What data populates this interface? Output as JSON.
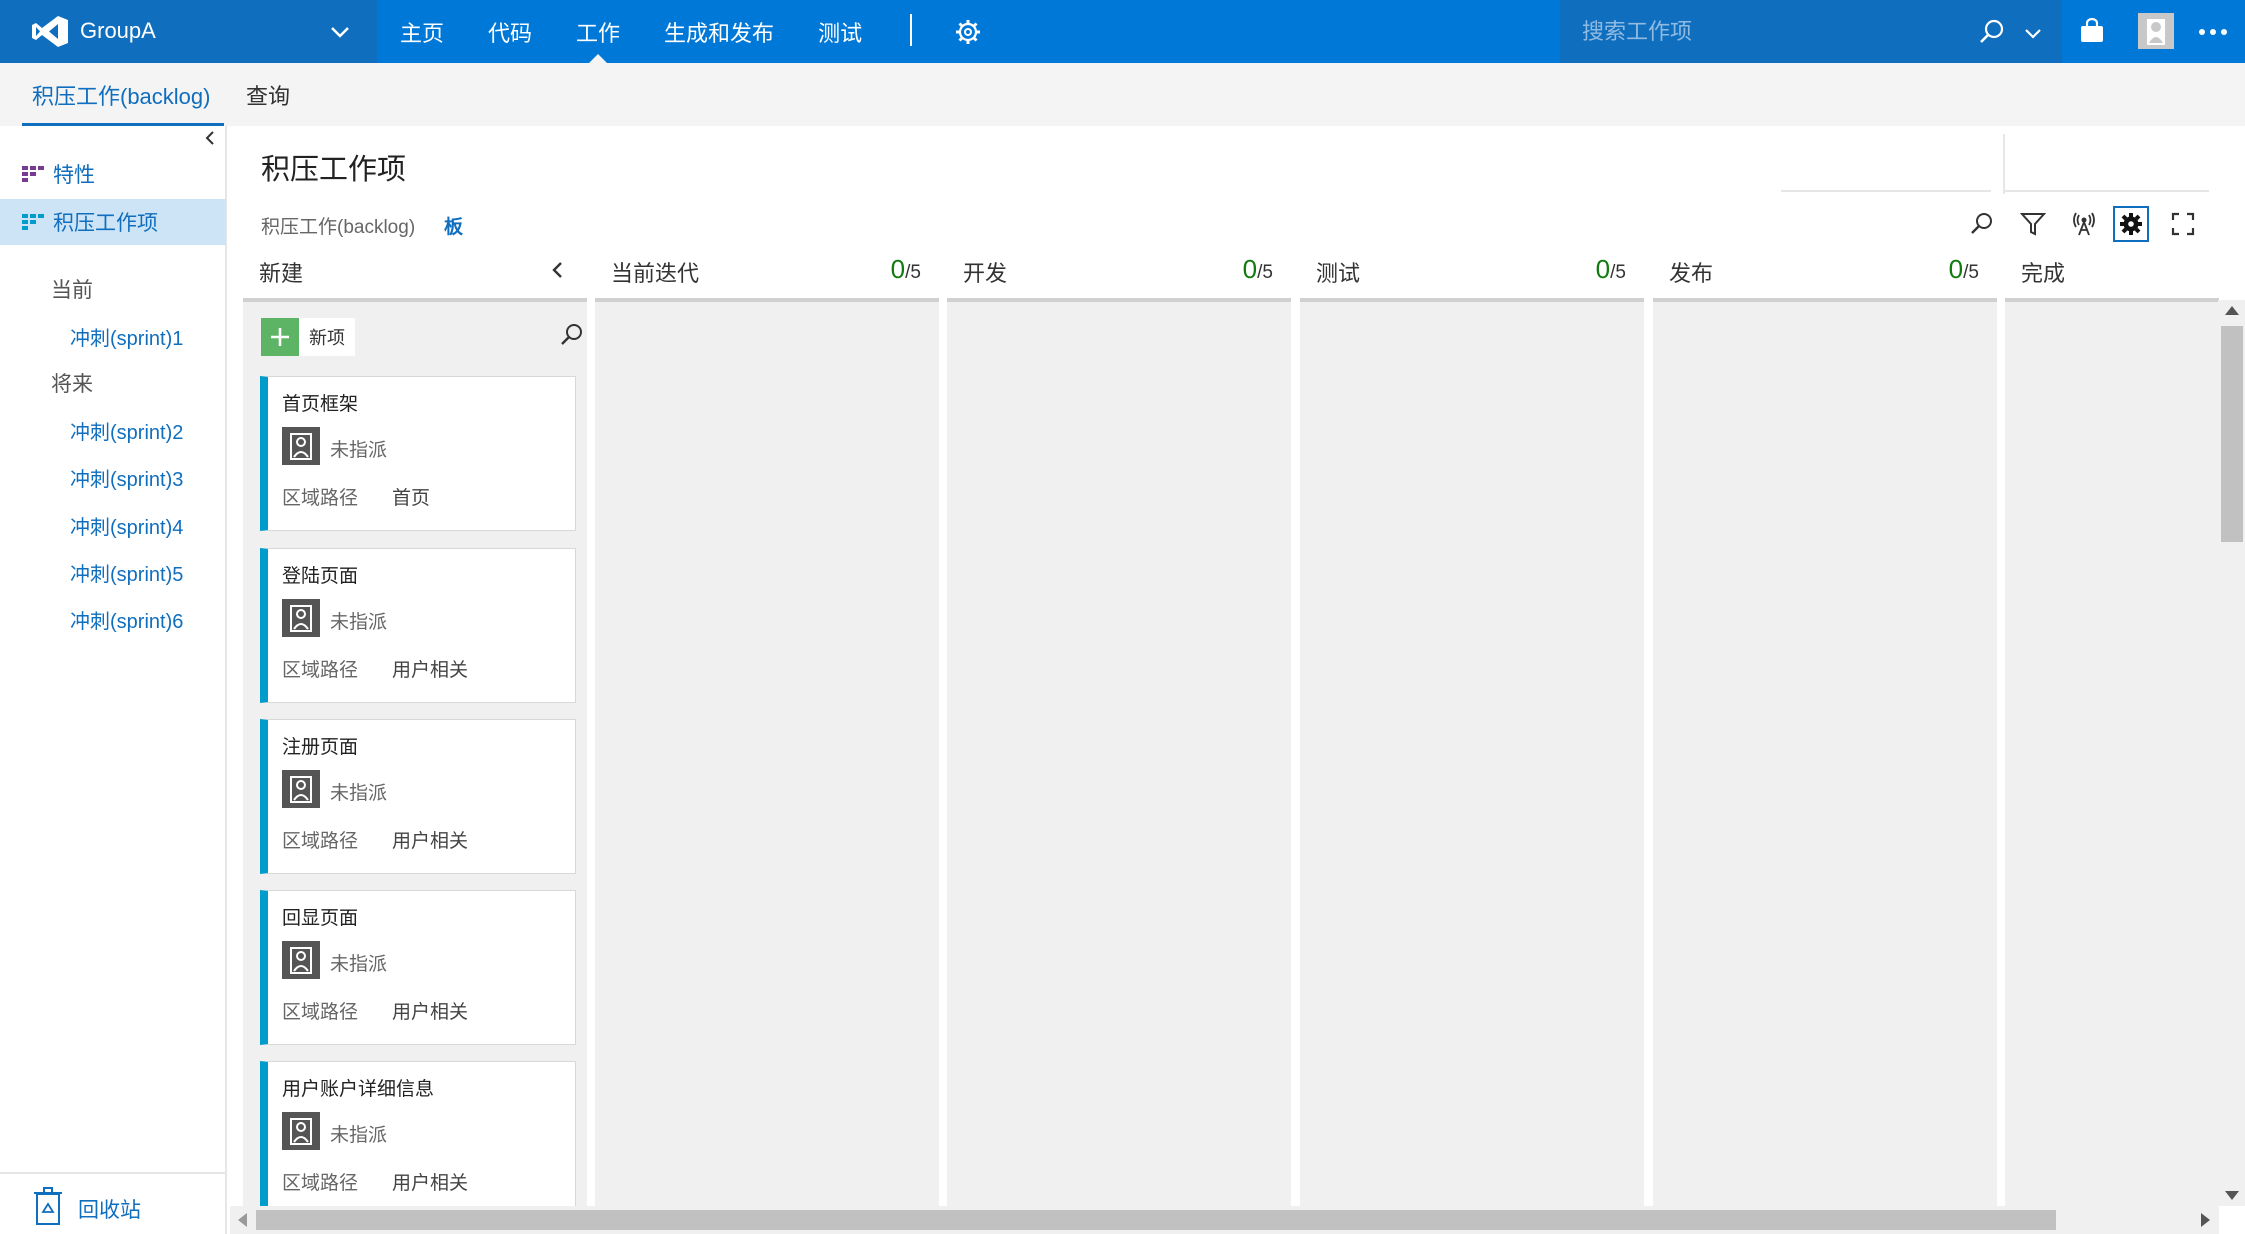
{
  "topbar": {
    "project_name": "GroupA",
    "nav": [
      "主页",
      "代码",
      "工作",
      "生成和发布",
      "测试"
    ],
    "active_nav": "工作",
    "search_placeholder": "搜索工作项"
  },
  "subnav": {
    "tabs": [
      "积压工作(backlog)",
      "查询"
    ],
    "active": "积压工作(backlog)"
  },
  "sidebar": {
    "items": [
      {
        "label": "特性",
        "icon": "backlog-icon"
      },
      {
        "label": "积压工作项",
        "icon": "backlog-icon",
        "selected": true
      }
    ],
    "current_label": "当前",
    "current_sprints": [
      "冲刺(sprint)1"
    ],
    "future_label": "将来",
    "future_sprints": [
      "冲刺(sprint)2",
      "冲刺(sprint)3",
      "冲刺(sprint)4",
      "冲刺(sprint)5",
      "冲刺(sprint)6"
    ],
    "recycle_label": "回收站"
  },
  "main": {
    "title": "积压工作项",
    "pivot_backlog": "积压工作(backlog)",
    "pivot_board": "板"
  },
  "board": {
    "add_label": "新项",
    "columns": [
      {
        "name": "新建",
        "count": "",
        "limit": ""
      },
      {
        "name": "当前迭代",
        "count": "0",
        "limit": "/5"
      },
      {
        "name": "开发",
        "count": "0",
        "limit": "/5"
      },
      {
        "name": "测试",
        "count": "0",
        "limit": "/5"
      },
      {
        "name": "发布",
        "count": "0",
        "limit": "/5"
      },
      {
        "name": "完成",
        "count": "",
        "limit": ""
      }
    ],
    "cards": [
      {
        "title": "首页框架",
        "assignee": "未指派",
        "area_label": "区域路径",
        "area": "首页"
      },
      {
        "title": "登陆页面",
        "assignee": "未指派",
        "area_label": "区域路径",
        "area": "用户相关"
      },
      {
        "title": "注册页面",
        "assignee": "未指派",
        "area_label": "区域路径",
        "area": "用户相关"
      },
      {
        "title": "回显页面",
        "assignee": "未指派",
        "area_label": "区域路径",
        "area": "用户相关"
      },
      {
        "title": "用户账户详细信息",
        "assignee": "未指派",
        "area_label": "区域路径",
        "area": "用户相关"
      }
    ]
  },
  "colors": {
    "brand": "#0078d7",
    "brand_dark": "#106ebe",
    "card_accent": "#009ccc",
    "wip_count": "#107c10",
    "add_green": "#5db465"
  }
}
